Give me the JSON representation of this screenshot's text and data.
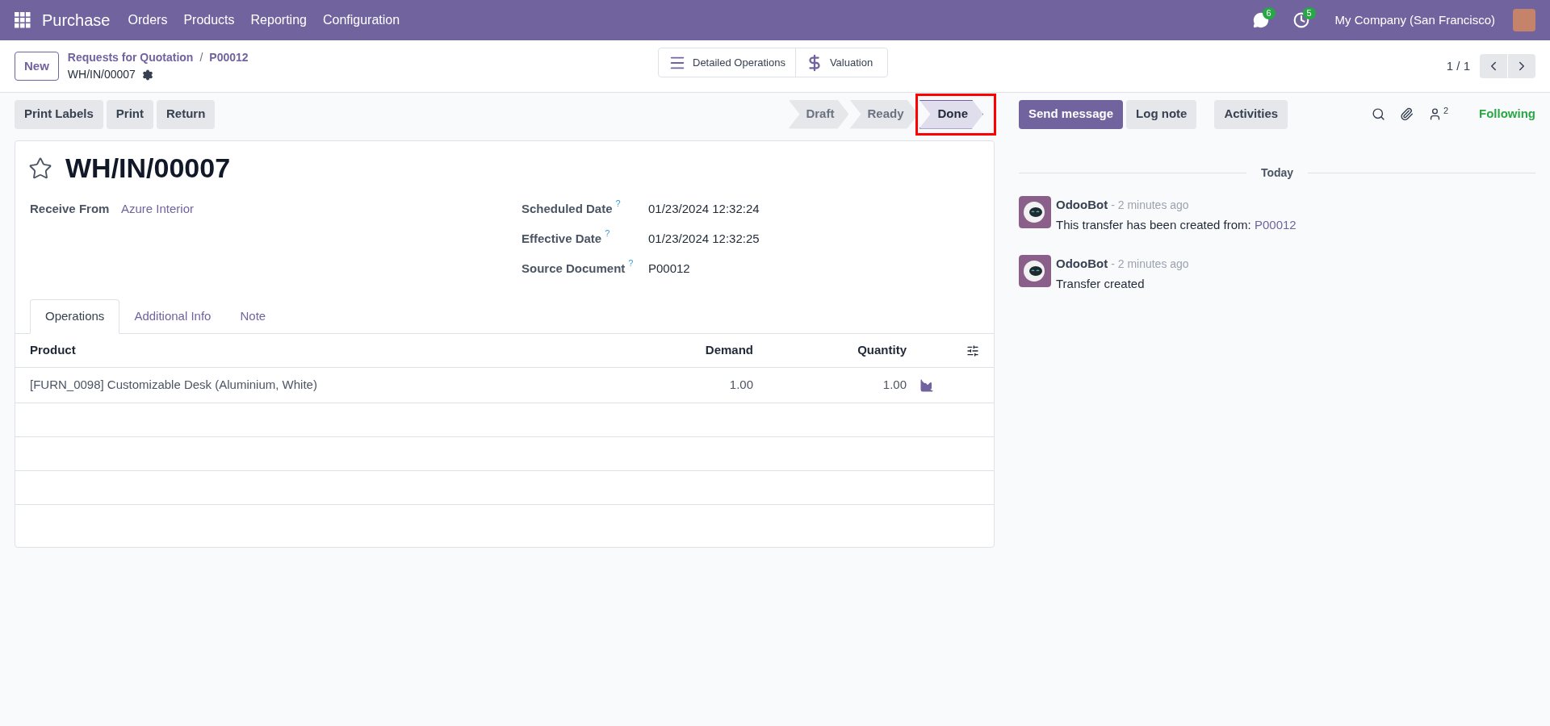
{
  "navbar": {
    "app": "Purchase",
    "menu": [
      "Orders",
      "Products",
      "Reporting",
      "Configuration"
    ],
    "messages_badge": "6",
    "activities_badge": "5",
    "company": "My Company (San Francisco)"
  },
  "control_panel": {
    "new_button": "New",
    "breadcrumbs": [
      "Requests for Quotation",
      "P00012"
    ],
    "breadcrumb_separator": "/",
    "record": "WH/IN/00007",
    "smart_buttons": [
      {
        "label": "Detailed Operations",
        "kind": "menu"
      },
      {
        "label": "Valuation",
        "kind": "dollar"
      }
    ],
    "pager": "1 / 1"
  },
  "actions": [
    "Print Labels",
    "Print",
    "Return"
  ],
  "status": [
    {
      "label": "Draft",
      "selected": false
    },
    {
      "label": "Ready",
      "selected": false
    },
    {
      "label": "Done",
      "selected": true
    }
  ],
  "form": {
    "title": "WH/IN/00007",
    "starred": false,
    "left_fields": [
      {
        "label": "Receive From",
        "value": "Azure Interior",
        "kind": "link"
      }
    ],
    "right_fields": [
      {
        "label": "Scheduled Date",
        "help": "?",
        "value": "01/23/2024 12:32:24"
      },
      {
        "label": "Effective Date",
        "help": "?",
        "value": "01/23/2024 12:32:25"
      },
      {
        "label": "Source Document",
        "help": "?",
        "value": "P00012"
      }
    ],
    "tabs": [
      {
        "label": "Operations",
        "selected": true
      },
      {
        "label": "Additional Info",
        "selected": false
      },
      {
        "label": "Note",
        "selected": false
      }
    ],
    "table": {
      "columns": [
        "Product",
        "Demand",
        "Quantity"
      ],
      "rows": [
        {
          "product": "[FURN_0098] Customizable Desk (Aluminium, White)",
          "demand": "1.00",
          "quantity": "1.00"
        }
      ]
    }
  },
  "chatter": {
    "buttons": [
      {
        "label": "Send message",
        "primary": true
      },
      {
        "label": "Log note",
        "primary": false
      },
      {
        "label": "Activities",
        "primary": false
      }
    ],
    "followers": "2",
    "following": "Following",
    "divider": "Today",
    "messages": [
      {
        "author": "OdooBot",
        "time": "- 2 minutes ago",
        "body": "This transfer has been created from: ",
        "link": "P00012"
      },
      {
        "author": "OdooBot",
        "time": "- 2 minutes ago",
        "body": "Transfer created"
      }
    ]
  }
}
